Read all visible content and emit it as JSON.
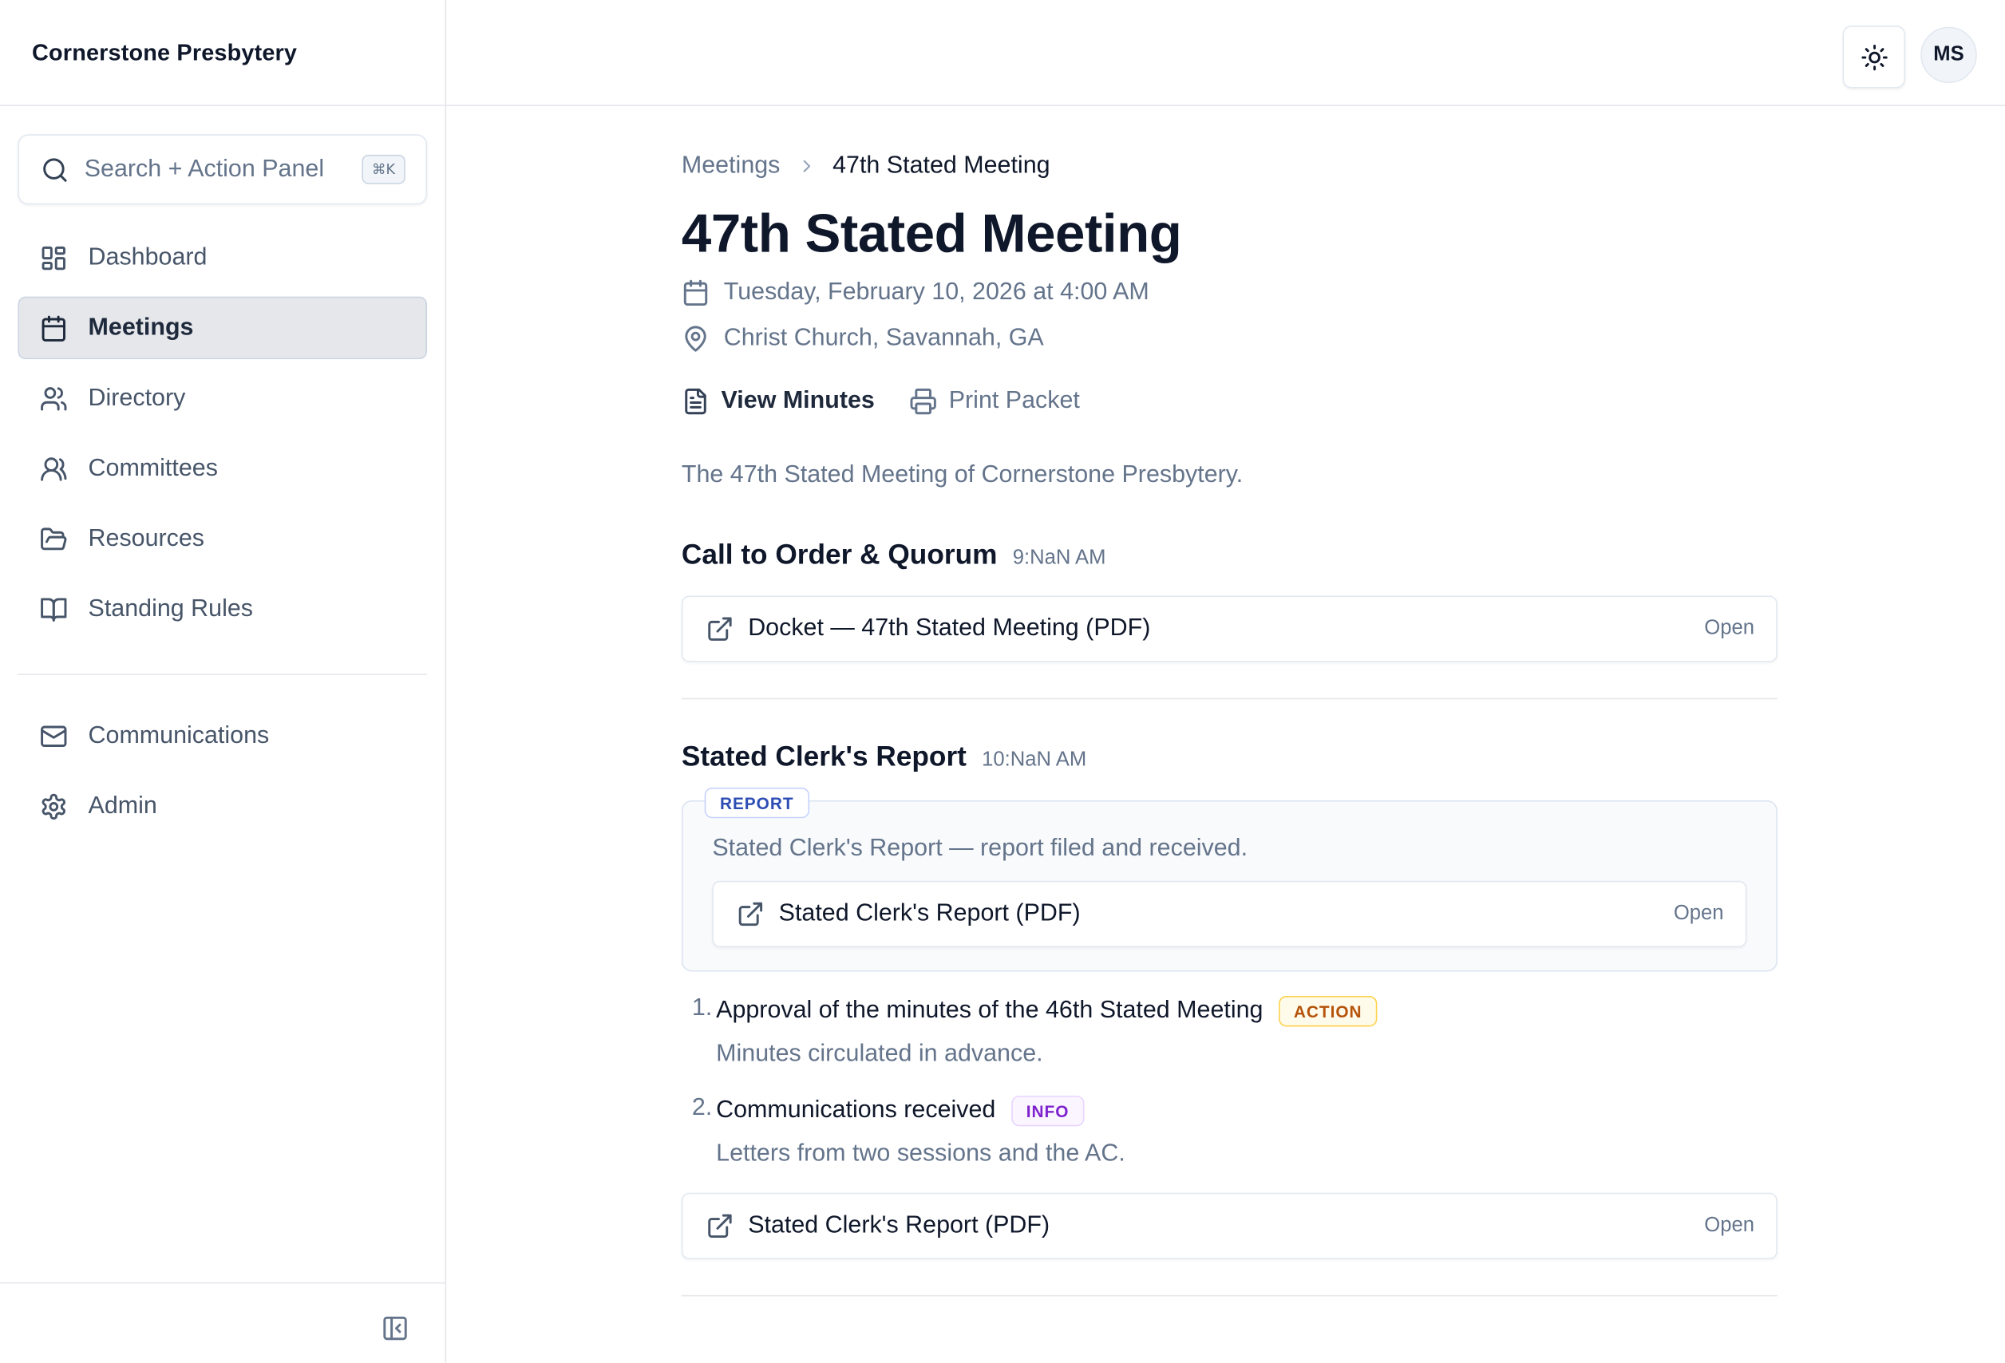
{
  "sidebar": {
    "brand": "Cornerstone Presbytery",
    "search": {
      "label": "Search + Action Panel",
      "shortcut": "⌘K"
    },
    "nav": [
      {
        "label": "Dashboard",
        "icon": "dashboard-icon"
      },
      {
        "label": "Meetings",
        "icon": "calendar-icon",
        "active": true
      },
      {
        "label": "Directory",
        "icon": "users-icon"
      },
      {
        "label": "Committees",
        "icon": "users-icon"
      },
      {
        "label": "Resources",
        "icon": "folder-icon"
      },
      {
        "label": "Standing Rules",
        "icon": "book-icon"
      }
    ],
    "nav_secondary": [
      {
        "label": "Communications",
        "icon": "mail-icon"
      },
      {
        "label": "Admin",
        "icon": "gear-icon"
      }
    ]
  },
  "topbar": {
    "avatar_initials": "MS",
    "theme_icon": "sun-icon"
  },
  "breadcrumb": {
    "parent": "Meetings",
    "current": "47th Stated Meeting"
  },
  "meeting": {
    "title": "47th Stated Meeting",
    "datetime": "Tuesday, February 10, 2026 at 4:00 AM",
    "location": "Christ Church, Savannah, GA",
    "actions": {
      "view_minutes": "View Minutes",
      "print_packet": "Print Packet"
    },
    "description": "The 47th Stated Meeting of Cornerstone Presbytery."
  },
  "sections": [
    {
      "title": "Call to Order & Quorum",
      "time": "9:NaN AM",
      "documents": [
        {
          "name": "Docket — 47th Stated Meeting (PDF)",
          "action": "Open"
        }
      ]
    },
    {
      "title": "Stated Clerk's Report",
      "time": "10:NaN AM",
      "report": {
        "badge": "REPORT",
        "text": "Stated Clerk's Report — report filed and received.",
        "document": {
          "name": "Stated Clerk's Report (PDF)",
          "action": "Open"
        }
      },
      "items": [
        {
          "number": "1.",
          "title": "Approval of the minutes of the 46th Stated Meeting",
          "badge": "ACTION",
          "note": "Minutes circulated in advance."
        },
        {
          "number": "2.",
          "title": "Communications received",
          "badge": "INFO",
          "note": "Letters from two sessions and the AC."
        }
      ],
      "documents": [
        {
          "name": "Stated Clerk's Report (PDF)",
          "action": "Open"
        }
      ]
    }
  ],
  "colors": {
    "active_nav_bg": "#e5e7eb",
    "report_badge": "#2d4db4",
    "action_badge": "#b45309",
    "info_badge": "#7e22ce"
  }
}
